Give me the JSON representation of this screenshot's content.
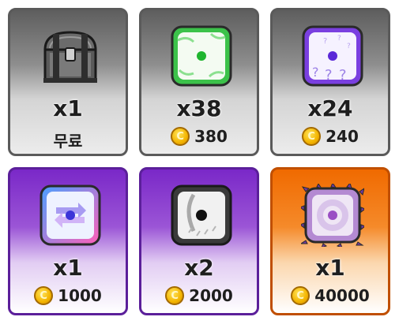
{
  "shop": {
    "items": [
      {
        "name": "chest",
        "quantity": "x1",
        "price_label": "무료",
        "free": true
      },
      {
        "name": "green-die",
        "quantity": "x38",
        "price": "380",
        "free": false
      },
      {
        "name": "mystery-die",
        "quantity": "x24",
        "price": "240",
        "free": false
      },
      {
        "name": "swap-die",
        "quantity": "x1",
        "price": "1000",
        "free": false
      },
      {
        "name": "scratch-die",
        "quantity": "x2",
        "price": "2000",
        "free": false
      },
      {
        "name": "thorn-die",
        "quantity": "x1",
        "price": "40000",
        "free": false
      }
    ],
    "coin_symbol": "C"
  },
  "colors": {
    "gray_card": "#8e8e8e",
    "purple_card": "#9b55d6",
    "orange_card": "#f58a2a",
    "coin": "#f3b400"
  }
}
